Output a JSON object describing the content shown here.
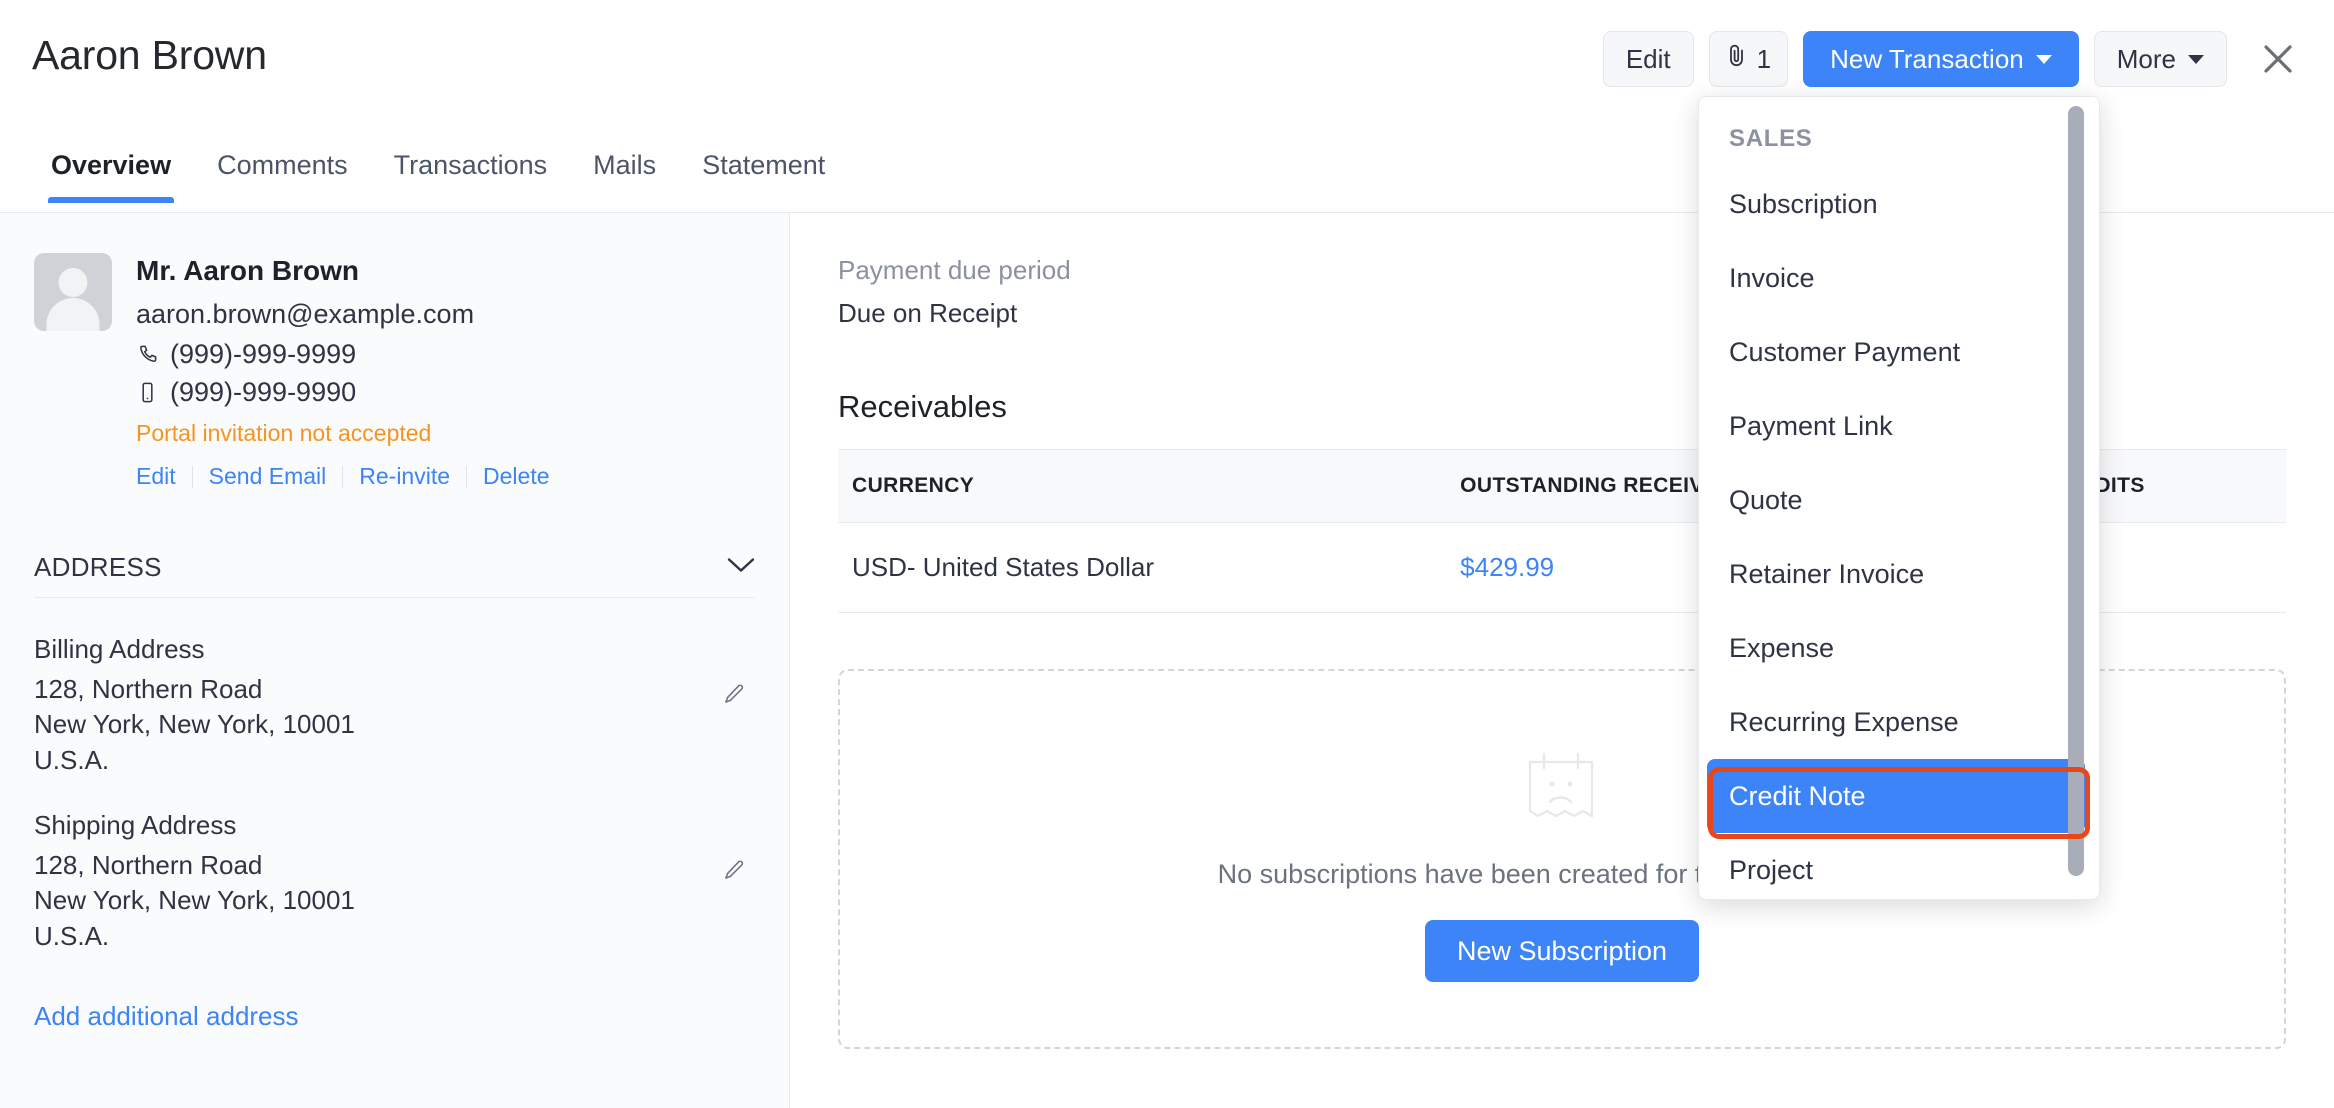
{
  "header": {
    "title": "Aaron Brown",
    "edit_label": "Edit",
    "attachment_count": "1",
    "new_transaction_label": "New Transaction",
    "more_label": "More",
    "close_label": "Close"
  },
  "tabs": [
    {
      "label": "Overview",
      "active": true
    },
    {
      "label": "Comments",
      "active": false
    },
    {
      "label": "Transactions",
      "active": false
    },
    {
      "label": "Mails",
      "active": false
    },
    {
      "label": "Statement",
      "active": false
    }
  ],
  "contact": {
    "name": "Mr. Aaron Brown",
    "email": "aaron.brown@example.com",
    "phone": "(999)-999-9999",
    "mobile": "(999)-999-9990",
    "portal_status": "Portal invitation not accepted",
    "links": [
      "Edit",
      "Send Email",
      "Re-invite",
      "Delete"
    ]
  },
  "address": {
    "section_label": "ADDRESS",
    "billing": {
      "title": "Billing Address",
      "line1": "128, Northern Road",
      "line2": "New York, New York, 10001",
      "line3": "U.S.A."
    },
    "shipping": {
      "title": "Shipping Address",
      "line1": "128, Northern Road",
      "line2": "New York, New York, 10001",
      "line3": "U.S.A."
    },
    "add_additional_label": "Add additional address"
  },
  "main": {
    "payment_due_label": "Payment due period",
    "payment_due_value": "Due on Receipt",
    "receivables_title": "Receivables",
    "receivables_table": {
      "columns": [
        "CURRENCY",
        "OUTSTANDING RECEIVABLES",
        "UNUSED CREDITS"
      ],
      "rows": [
        {
          "currency": "USD- United States Dollar",
          "outstanding": "$429.99",
          "unused_credits": ""
        }
      ]
    },
    "empty_state": {
      "text": "No subscriptions have been created for this customer yet.",
      "button_label": "New Subscription"
    }
  },
  "dropdown": {
    "group_label": "SALES",
    "items": [
      {
        "label": "Subscription",
        "highlighted": false
      },
      {
        "label": "Invoice",
        "highlighted": false
      },
      {
        "label": "Customer Payment",
        "highlighted": false
      },
      {
        "label": "Payment Link",
        "highlighted": false
      },
      {
        "label": "Quote",
        "highlighted": false
      },
      {
        "label": "Retainer Invoice",
        "highlighted": false
      },
      {
        "label": "Expense",
        "highlighted": false
      },
      {
        "label": "Recurring Expense",
        "highlighted": false
      },
      {
        "label": "Credit Note",
        "highlighted": true
      },
      {
        "label": "Project",
        "highlighted": false
      }
    ]
  },
  "colors": {
    "accent_blue": "#3c84f7",
    "highlight_ring": "#e8471c",
    "warning_orange": "#f7941d",
    "text_primary": "#2f3445",
    "text_muted": "#8b91a1",
    "border": "#e8eaed",
    "sidebar_bg": "#fafbfc"
  }
}
